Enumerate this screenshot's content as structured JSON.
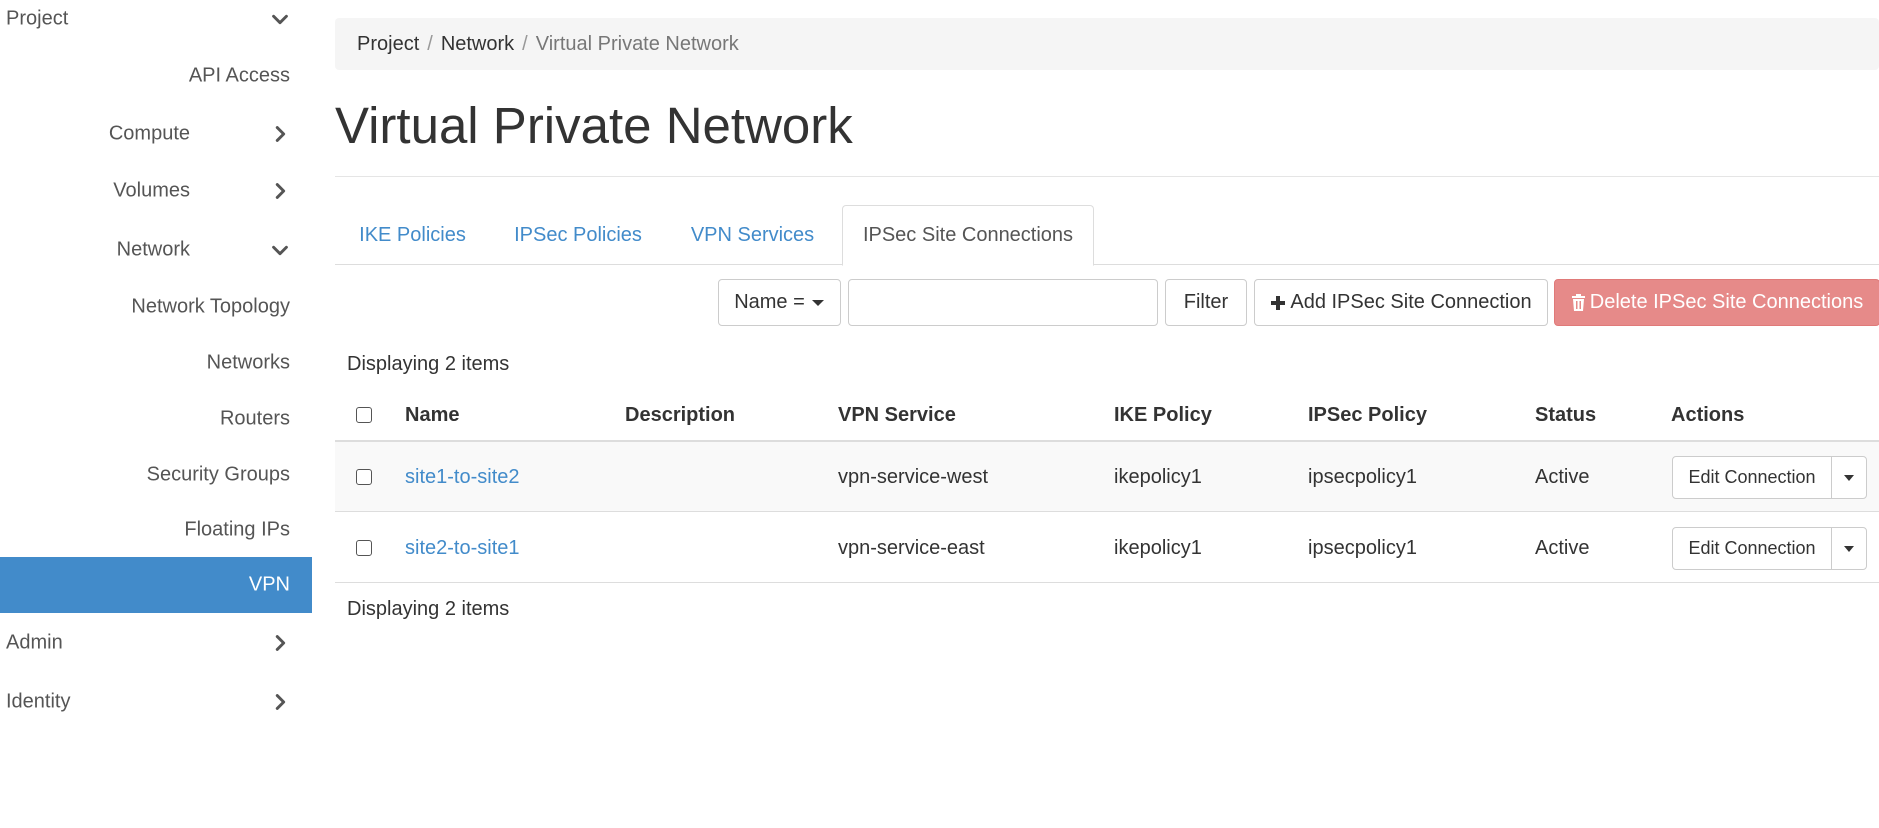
{
  "sidebar": {
    "items": [
      {
        "label": "Project",
        "chevron": "chevron-down"
      },
      {
        "label": "API Access"
      },
      {
        "label": "Compute",
        "chevron": "chevron-right"
      },
      {
        "label": "Volumes",
        "chevron": "chevron-right"
      },
      {
        "label": "Network",
        "chevron": "chevron-down"
      },
      {
        "label": "Network Topology"
      },
      {
        "label": "Networks"
      },
      {
        "label": "Routers"
      },
      {
        "label": "Security Groups"
      },
      {
        "label": "Floating IPs"
      },
      {
        "label": "VPN",
        "active": true
      },
      {
        "label": "Admin",
        "chevron": "chevron-right"
      },
      {
        "label": "Identity",
        "chevron": "chevron-right"
      }
    ]
  },
  "breadcrumb": [
    "Project",
    "Network",
    "Virtual Private Network"
  ],
  "page_title": "Virtual Private Network",
  "tabs": [
    {
      "label": "IKE Policies"
    },
    {
      "label": "IPSec Policies"
    },
    {
      "label": "VPN Services"
    },
    {
      "label": "IPSec Site Connections",
      "active": true
    }
  ],
  "toolbar": {
    "filter_field": "Name =",
    "filter_value": "",
    "filter_button": "Filter",
    "add_button": "Add IPSec Site Connection",
    "delete_button": "Delete IPSec Site Connections"
  },
  "table": {
    "count_top": "Displaying 2 items",
    "count_bottom": "Displaying 2 items",
    "columns": [
      "Name",
      "Description",
      "VPN Service",
      "IKE Policy",
      "IPSec Policy",
      "Status",
      "Actions"
    ],
    "rows": [
      {
        "name": "site1-to-site2",
        "description": "",
        "vpn_service": "vpn-service-west",
        "ike_policy": "ikepolicy1",
        "ipsec_policy": "ipsecpolicy1",
        "status": "Active",
        "action": "Edit Connection"
      },
      {
        "name": "site2-to-site1",
        "description": "",
        "vpn_service": "vpn-service-east",
        "ike_policy": "ikepolicy1",
        "ipsec_policy": "ipsecpolicy1",
        "status": "Active",
        "action": "Edit Connection"
      }
    ]
  },
  "colors": {
    "accent": "#428bca",
    "danger": "#e68a89",
    "breadcrumb_bg": "#f5f5f5"
  }
}
